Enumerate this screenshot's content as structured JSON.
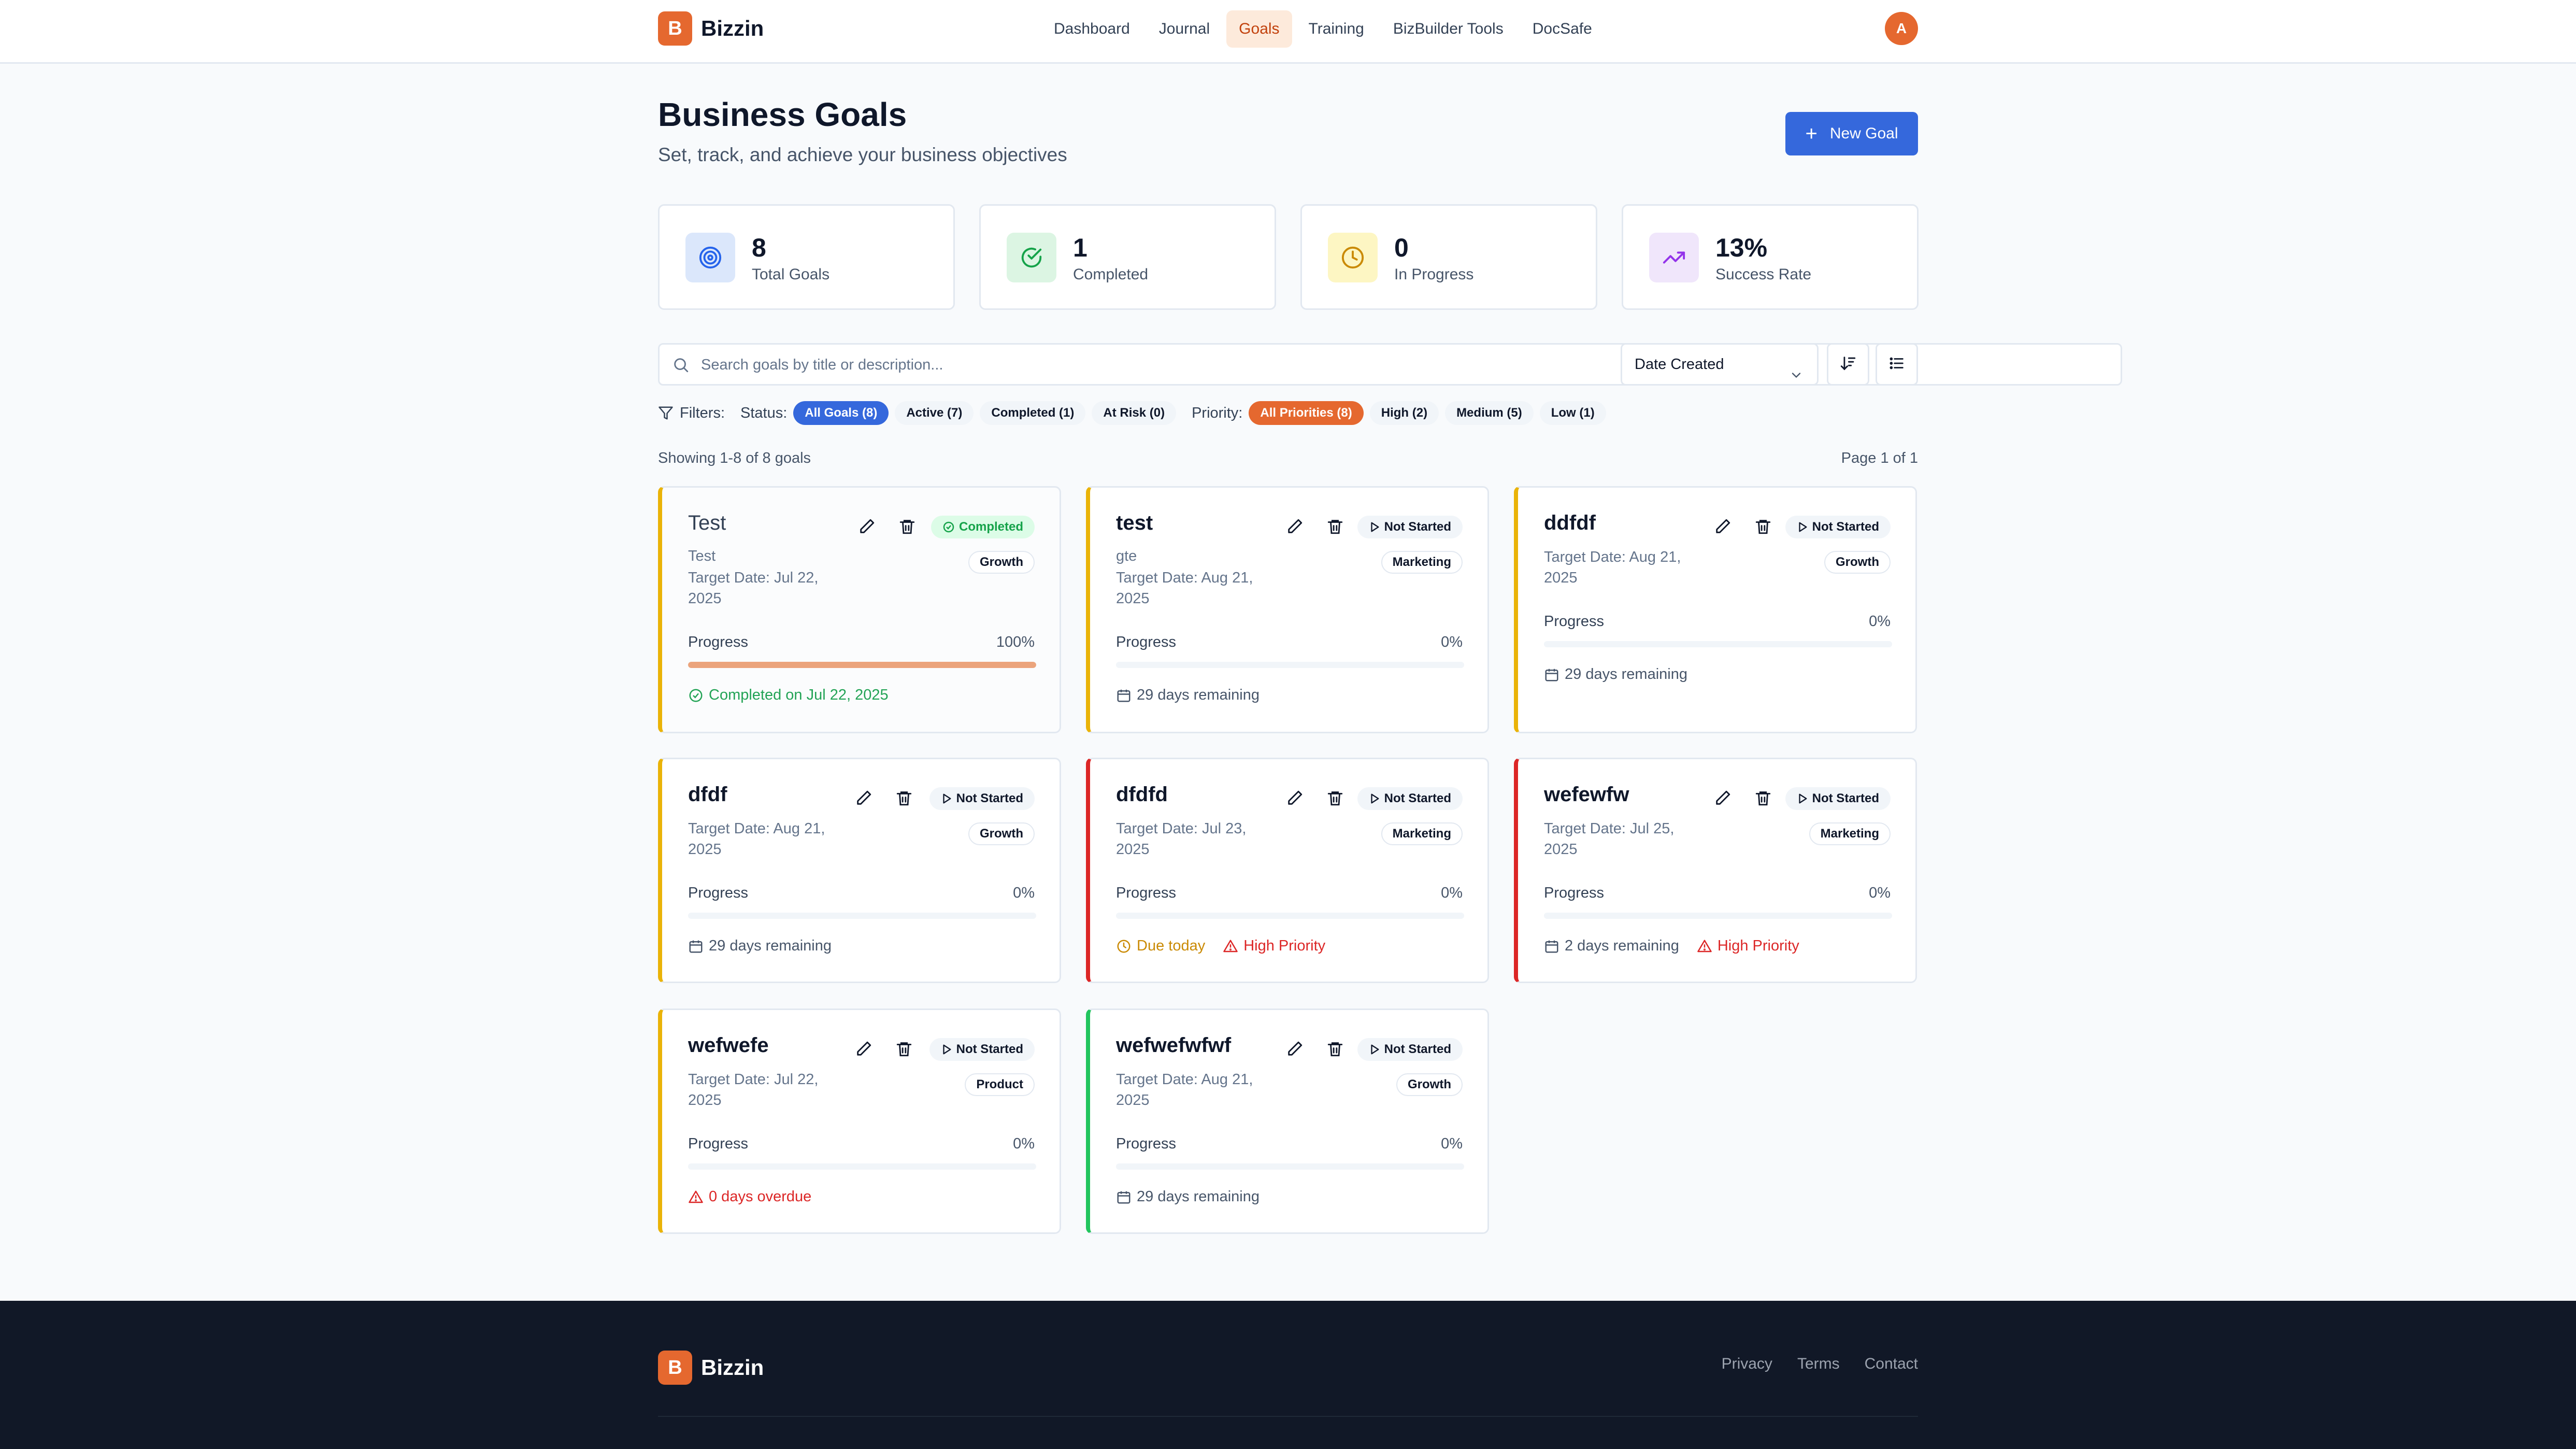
{
  "app": {
    "name": "Bizzin",
    "logo_letter": "B"
  },
  "nav": {
    "items": [
      "Dashboard",
      "Journal",
      "Goals",
      "Training",
      "BizBuilder Tools",
      "DocSafe"
    ],
    "active": "Goals"
  },
  "user": {
    "avatar_letter": "A"
  },
  "page": {
    "title": "Business Goals",
    "subtitle": "Set, track, and achieve your business objectives",
    "new_goal_label": "New Goal"
  },
  "stats": [
    {
      "value": "8",
      "label": "Total Goals",
      "icon": "target-icon",
      "color": "#2563eb"
    },
    {
      "value": "1",
      "label": "Completed",
      "icon": "check-circle-icon",
      "color": "#16a34a"
    },
    {
      "value": "0",
      "label": "In Progress",
      "icon": "clock-icon",
      "color": "#ca8a04"
    },
    {
      "value": "13%",
      "label": "Success Rate",
      "icon": "trending-up-icon",
      "color": "#9333ea"
    }
  ],
  "search": {
    "placeholder": "Search goals by title or description...",
    "value": ""
  },
  "sort": {
    "selected": "Date Created"
  },
  "filters": {
    "label": "Filters:",
    "status_label": "Status:",
    "status": [
      "All Goals (8)",
      "Active (7)",
      "Completed (1)",
      "At Risk (0)"
    ],
    "priority_label": "Priority:",
    "priority": [
      "All Priorities (8)",
      "High (2)",
      "Medium (5)",
      "Low (1)"
    ]
  },
  "results": {
    "showing": "Showing 1-8 of 8 goals",
    "page": "Page 1 of 1"
  },
  "goals": [
    {
      "title": "Test",
      "description": "Test",
      "target": "Target Date: Jul 22, 2025",
      "status": "Completed",
      "category": "Growth",
      "progress_label": "Progress",
      "progress_text": "100%",
      "progress": 100,
      "footer": [
        "Completed on Jul 22, 2025"
      ]
    },
    {
      "title": "test",
      "description": "gte",
      "target": "Target Date: Aug 21, 2025",
      "status": "Not Started",
      "category": "Marketing",
      "progress_label": "Progress",
      "progress_text": "0%",
      "progress": 0,
      "footer": [
        "29 days remaining"
      ]
    },
    {
      "title": "ddfdf",
      "target": "Target Date: Aug 21, 2025",
      "status": "Not Started",
      "category": "Growth",
      "progress_label": "Progress",
      "progress_text": "0%",
      "progress": 0,
      "footer": [
        "29 days remaining"
      ]
    },
    {
      "title": "dfdf",
      "target": "Target Date: Aug 21, 2025",
      "status": "Not Started",
      "category": "Growth",
      "progress_label": "Progress",
      "progress_text": "0%",
      "progress": 0,
      "footer": [
        "29 days remaining"
      ]
    },
    {
      "title": "dfdfd",
      "target": "Target Date: Jul 23, 2025",
      "status": "Not Started",
      "category": "Marketing",
      "progress_label": "Progress",
      "progress_text": "0%",
      "progress": 0,
      "footer": [
        "Due today",
        "High Priority"
      ]
    },
    {
      "title": "wefewfw",
      "target": "Target Date: Jul 25, 2025",
      "status": "Not Started",
      "category": "Marketing",
      "progress_label": "Progress",
      "progress_text": "0%",
      "progress": 0,
      "footer": [
        "2 days remaining",
        "High Priority"
      ]
    },
    {
      "title": "wefwefe",
      "target": "Target Date: Jul 22, 2025",
      "status": "Not Started",
      "category": "Product",
      "progress_label": "Progress",
      "progress_text": "0%",
      "progress": 0,
      "footer": [
        "0 days overdue"
      ]
    },
    {
      "title": "wefwefwfwf",
      "target": "Target Date: Aug 21, 2025",
      "status": "Not Started",
      "category": "Growth",
      "progress_label": "Progress",
      "progress_text": "0%",
      "progress": 0,
      "footer": [
        "29 days remaining"
      ]
    }
  ],
  "footer": {
    "links": [
      "Privacy",
      "Terms",
      "Contact"
    ]
  },
  "colors": {
    "brand": "#e5682f",
    "primary": "#3568dc",
    "priority_high": "#dc2626",
    "priority_medium": "#eab308",
    "priority_low": "#22c55e"
  }
}
